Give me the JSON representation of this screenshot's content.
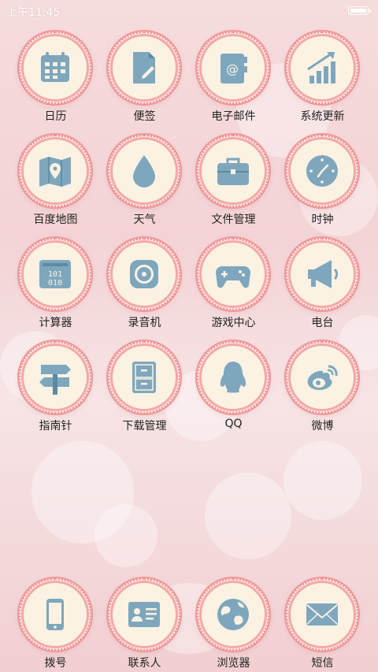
{
  "status_bar": {
    "time": "上午11:45"
  },
  "apps": [
    {
      "label": "日历",
      "icon": "calendar-icon"
    },
    {
      "label": "便签",
      "icon": "note-icon"
    },
    {
      "label": "电子邮件",
      "icon": "mail-icon"
    },
    {
      "label": "系统更新",
      "icon": "update-chart-icon"
    },
    {
      "label": "百度地图",
      "icon": "map-icon"
    },
    {
      "label": "天气",
      "icon": "drop-icon"
    },
    {
      "label": "文件管理",
      "icon": "briefcase-icon"
    },
    {
      "label": "时钟",
      "icon": "clock-icon"
    },
    {
      "label": "计算器",
      "icon": "calculator-icon"
    },
    {
      "label": "录音机",
      "icon": "recorder-icon"
    },
    {
      "label": "游戏中心",
      "icon": "gamepad-icon"
    },
    {
      "label": "电台",
      "icon": "megaphone-icon"
    },
    {
      "label": "指南针",
      "icon": "signpost-icon"
    },
    {
      "label": "下载管理",
      "icon": "cabinet-icon"
    },
    {
      "label": "QQ",
      "icon": "penguin-icon"
    },
    {
      "label": "微博",
      "icon": "weibo-icon"
    }
  ],
  "dock": [
    {
      "label": "拨号",
      "icon": "phone-icon"
    },
    {
      "label": "联系人",
      "icon": "contact-card-icon"
    },
    {
      "label": "浏览器",
      "icon": "globe-icon"
    },
    {
      "label": "短信",
      "icon": "envelope-icon"
    }
  ],
  "colors": {
    "icon": "#7ea7bd",
    "ring": "#f09697",
    "circle": "#fbf2e3"
  }
}
